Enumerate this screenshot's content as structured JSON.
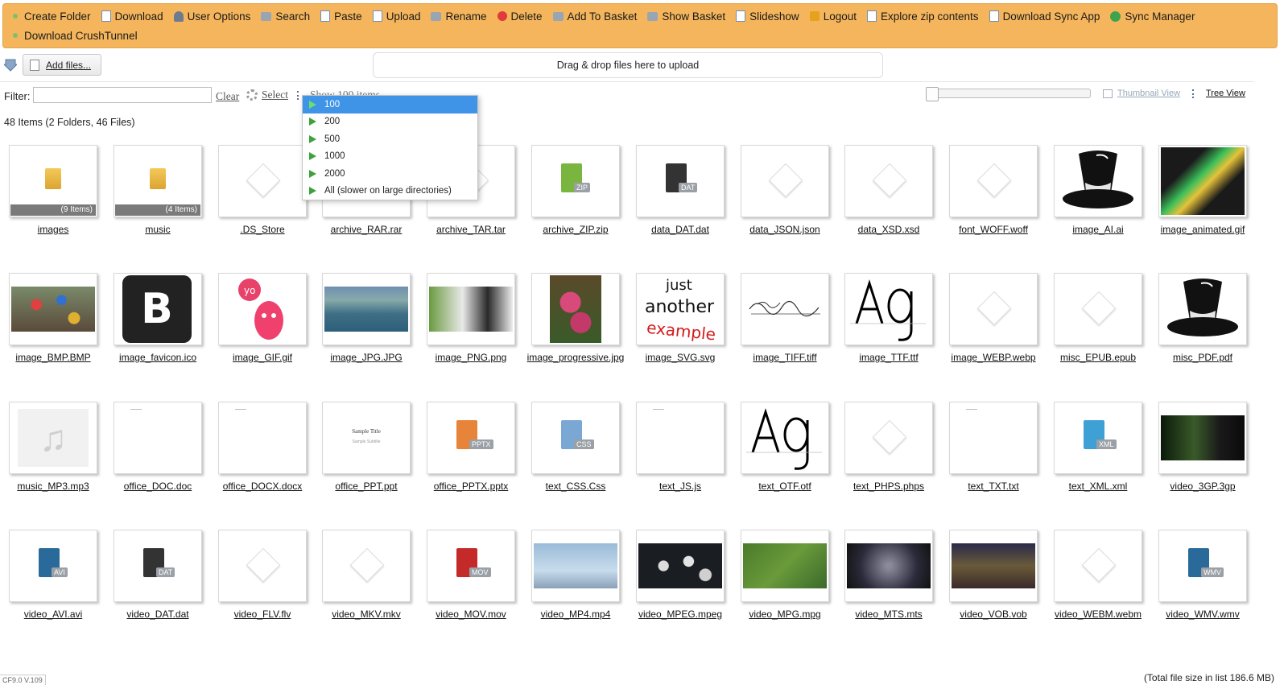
{
  "toolbar": {
    "items": [
      {
        "label": "Create Folder",
        "icon": "green-dot-icon"
      },
      {
        "label": "Download",
        "icon": "download-icon"
      },
      {
        "label": "User Options",
        "icon": "user-options-icon"
      },
      {
        "label": "Search",
        "icon": "search-icon"
      },
      {
        "label": "Paste",
        "icon": "paste-icon"
      },
      {
        "label": "Upload",
        "icon": "upload-icon"
      },
      {
        "label": "Rename",
        "icon": "rename-icon"
      },
      {
        "label": "Delete",
        "icon": "delete-icon"
      },
      {
        "label": "Add To Basket",
        "icon": "basket-add-icon"
      },
      {
        "label": "Show Basket",
        "icon": "basket-icon"
      },
      {
        "label": "Slideshow",
        "icon": "slideshow-icon"
      },
      {
        "label": "Logout",
        "icon": "logout-icon"
      },
      {
        "label": "Explore zip contents",
        "icon": "zip-icon"
      },
      {
        "label": "Download Sync App",
        "icon": "download-sync-icon"
      },
      {
        "label": "Sync Manager",
        "icon": "sync-icon"
      },
      {
        "label": "Download CrushTunnel",
        "icon": "green-dot-icon"
      }
    ]
  },
  "upload": {
    "add_files": "Add files...",
    "dropzone": "Drag & drop files here to upload"
  },
  "filter": {
    "label": "Filter:",
    "value": "",
    "clear": "Clear",
    "select": "Select",
    "show": "Show 100 items"
  },
  "view": {
    "thumbnail": "Thumbnail View",
    "tree": "Tree View"
  },
  "dropdown": {
    "options": [
      "100",
      "200",
      "500",
      "1000",
      "2000",
      "All (slower on large directories)"
    ],
    "selected": "100"
  },
  "summary": {
    "count": "48 Items (2 Folders, 46 Files)",
    "total": "(Total file size in list 186.6 MB)",
    "version": "CF9.0 V.109"
  },
  "files": [
    {
      "name": "images",
      "kind": "folder",
      "count": "(9 Items)"
    },
    {
      "name": "music",
      "kind": "folder",
      "count": "(4 Items)"
    },
    {
      "name": ".DS_Store",
      "kind": "generic"
    },
    {
      "name": "archive_RAR.rar",
      "kind": "generic"
    },
    {
      "name": "archive_TAR.tar",
      "kind": "generic"
    },
    {
      "name": "archive_ZIP.zip",
      "kind": "badge",
      "badge": "ZIP",
      "color": "#7ab63f"
    },
    {
      "name": "data_DAT.dat",
      "kind": "badge",
      "badge": "DAT",
      "color": "#333333"
    },
    {
      "name": "data_JSON.json",
      "kind": "generic"
    },
    {
      "name": "data_XSD.xsd",
      "kind": "generic"
    },
    {
      "name": "font_WOFF.woff",
      "kind": "generic"
    },
    {
      "name": "image_AI.ai",
      "kind": "hat"
    },
    {
      "name": "image_animated.gif",
      "kind": "photo",
      "bg": "linear-gradient(135deg,#1a1a1a 30%,#3cbf5a 45%,#e6c23a 55%,#1a1a1a 70%)"
    },
    {
      "name": "image_BMP.BMP",
      "kind": "photo",
      "bg": "radial-gradient(circle at 30% 40%,#e04040 8%,transparent 9%),radial-gradient(circle at 60% 30%,#3070d0 8%,transparent 9%),radial-gradient(circle at 75% 70%,#e0b030 8%,transparent 9%),linear-gradient(#7a8a6a,#5a4a3a)",
      "wide": true
    },
    {
      "name": "image_favicon.ico",
      "kind": "favicon"
    },
    {
      "name": "image_GIF.gif",
      "kind": "gif"
    },
    {
      "name": "image_JPG.JPG",
      "kind": "photo",
      "bg": "linear-gradient(#6f8fb0 0%,#8aa 30%,#3f6f86 60%,#2d5f7a 100%)",
      "wide": true
    },
    {
      "name": "image_PNG.png",
      "kind": "photo",
      "bg": "linear-gradient(90deg,#6a9a40 0%,#e9e9e9 40%,#2a2a2a 70%,#ededed 100%)",
      "wide": true
    },
    {
      "name": "image_progressive.jpg",
      "kind": "photo",
      "bg": "radial-gradient(circle at 40% 40%,#d84a7a 20%,transparent 21%),radial-gradient(circle at 60% 70%,#c33a6a 18%,transparent 19%),linear-gradient(#5a4a2a,#3a5a2a)",
      "tall": true
    },
    {
      "name": "image_SVG.svg",
      "kind": "svgtext"
    },
    {
      "name": "image_TIFF.tiff",
      "kind": "tiff"
    },
    {
      "name": "image_TTF.ttf",
      "kind": "ag"
    },
    {
      "name": "image_WEBP.webp",
      "kind": "generic"
    },
    {
      "name": "misc_EPUB.epub",
      "kind": "generic"
    },
    {
      "name": "misc_PDF.pdf",
      "kind": "hat"
    },
    {
      "name": "music_MP3.mp3",
      "kind": "music"
    },
    {
      "name": "office_DOC.doc",
      "kind": "page"
    },
    {
      "name": "office_DOCX.docx",
      "kind": "page"
    },
    {
      "name": "office_PPT.ppt",
      "kind": "ppt",
      "title": "Sample Title",
      "subtitle": "Sample Subtitle"
    },
    {
      "name": "office_PPTX.pptx",
      "kind": "badge",
      "badge": "PPTX",
      "color": "#e8833a"
    },
    {
      "name": "text_CSS.Css",
      "kind": "badge",
      "badge": "CSS",
      "color": "#7aa7d4"
    },
    {
      "name": "text_JS.js",
      "kind": "page"
    },
    {
      "name": "text_OTF.otf",
      "kind": "ag"
    },
    {
      "name": "text_PHPS.phps",
      "kind": "generic"
    },
    {
      "name": "text_TXT.txt",
      "kind": "page"
    },
    {
      "name": "text_XML.xml",
      "kind": "badge",
      "badge": "XML",
      "color": "#3fa0d6"
    },
    {
      "name": "video_3GP.3gp",
      "kind": "photo",
      "bg": "linear-gradient(90deg,#0a1a0a,#3a5a2a 40%,#1a1a1a 70%,#0a0a0a)",
      "wide": true
    },
    {
      "name": "video_AVI.avi",
      "kind": "badge",
      "badge": "AVI",
      "color": "#2a6a9a"
    },
    {
      "name": "video_DAT.dat",
      "kind": "badge",
      "badge": "DAT",
      "color": "#333333"
    },
    {
      "name": "video_FLV.flv",
      "kind": "generic"
    },
    {
      "name": "video_MKV.mkv",
      "kind": "generic"
    },
    {
      "name": "video_MOV.mov",
      "kind": "badge",
      "badge": "MOV",
      "color": "#c42a2a"
    },
    {
      "name": "video_MP4.mp4",
      "kind": "photo",
      "bg": "linear-gradient(#9abbd8,#c7dcec 60%,#8aa0b8)",
      "wide": true
    },
    {
      "name": "video_MPEG.mpeg",
      "kind": "photo",
      "bg": "radial-gradient(circle at 30% 50%,#dcdcdc 8%,transparent 9%),radial-gradient(circle at 60% 40%,#e4e4e4 9%,transparent 10%),radial-gradient(circle at 80% 70%,#d0d0d0 8%,transparent 9%),#1a1d22",
      "wide": true
    },
    {
      "name": "video_MPG.mpg",
      "kind": "photo",
      "bg": "linear-gradient(135deg,#4a7a2a,#6a9a3a 50%,#3a6a2a)",
      "wide": true
    },
    {
      "name": "video_MTS.mts",
      "kind": "photo",
      "bg": "radial-gradient(circle at 50% 50%,#8a8a9a 5%,#2a2a3a 60%,#111 100%)",
      "wide": true
    },
    {
      "name": "video_VOB.vob",
      "kind": "photo",
      "bg": "linear-gradient(#2a2a4a,#6a5a3a 50%,#3a2a2a)",
      "wide": true
    },
    {
      "name": "video_WEBM.webm",
      "kind": "generic"
    },
    {
      "name": "video_WMV.wmv",
      "kind": "badge",
      "badge": "WMV",
      "color": "#2a6a9a"
    }
  ]
}
